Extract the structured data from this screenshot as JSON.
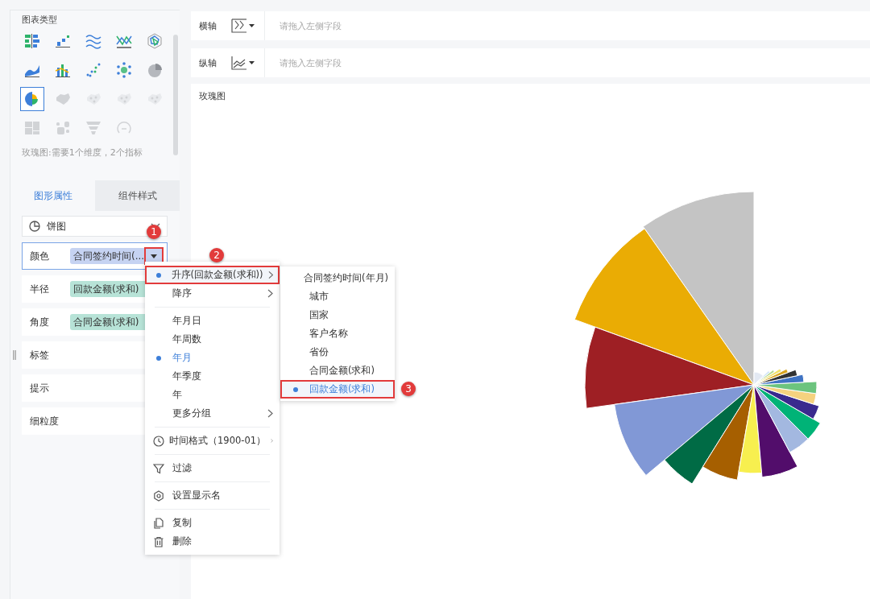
{
  "chart_type_panel": {
    "title": "图表类型",
    "types": [
      {
        "kind": "grouped-bar",
        "selected": false,
        "disabled": false
      },
      {
        "kind": "step-scatter",
        "selected": false,
        "disabled": false
      },
      {
        "kind": "line-wave",
        "selected": false,
        "disabled": false
      },
      {
        "kind": "line-cross",
        "selected": false,
        "disabled": false
      },
      {
        "kind": "radar",
        "selected": false,
        "disabled": false
      },
      {
        "kind": "area",
        "selected": false,
        "disabled": false
      },
      {
        "kind": "combo",
        "selected": false,
        "disabled": false
      },
      {
        "kind": "dot-scatter",
        "selected": false,
        "disabled": false
      },
      {
        "kind": "bubble",
        "selected": false,
        "disabled": false
      },
      {
        "kind": "pie",
        "selected": false,
        "disabled": false
      },
      {
        "kind": "rose",
        "selected": true,
        "disabled": false
      },
      {
        "kind": "map",
        "selected": false,
        "disabled": true
      },
      {
        "kind": "map-points",
        "selected": false,
        "disabled": true
      },
      {
        "kind": "map-points",
        "selected": false,
        "disabled": true
      },
      {
        "kind": "map-points",
        "selected": false,
        "disabled": true
      },
      {
        "kind": "treemap",
        "selected": false,
        "disabled": true
      },
      {
        "kind": "word-cloud",
        "selected": false,
        "disabled": true
      },
      {
        "kind": "funnel",
        "selected": false,
        "disabled": true
      },
      {
        "kind": "gauge",
        "selected": false,
        "disabled": true
      }
    ],
    "caption": "玫瑰图:需要1个维度，2个指标"
  },
  "property_tabs": [
    {
      "label": "图形属性",
      "selected": true
    },
    {
      "label": "组件样式",
      "selected": false
    }
  ],
  "shape_select": {
    "value": "饼图"
  },
  "properties": [
    {
      "label": "颜色",
      "field": "合同签约时间(...",
      "kind": "dimension",
      "active": true,
      "callout": "1"
    },
    {
      "label": "半径",
      "field": "回款金额(求和)",
      "kind": "measure",
      "active": false
    },
    {
      "label": "角度",
      "field": "合同金额(求和)",
      "kind": "measure",
      "active": false
    },
    {
      "label": "标签",
      "kind": "empty",
      "active": false
    },
    {
      "label": "提示",
      "kind": "empty",
      "active": false
    },
    {
      "label": "细粒度",
      "kind": "empty",
      "active": false
    }
  ],
  "axes": [
    {
      "label": "横轴",
      "placeholder": "请拖入左侧字段"
    },
    {
      "label": "纵轴",
      "placeholder": "请拖入左侧字段"
    }
  ],
  "chart": {
    "title": "玫瑰图"
  },
  "context_menu": {
    "groups": [
      [
        {
          "label": "升序(回款金额(求和))",
          "selected": true,
          "submenu": true,
          "highlighted": true,
          "callout": "2"
        },
        {
          "label": "降序",
          "selected": false,
          "submenu": true,
          "highlighted": false
        }
      ],
      [
        {
          "label": "年月日",
          "selected": false,
          "submenu": false,
          "highlighted": false
        },
        {
          "label": "年周数",
          "selected": false,
          "submenu": false,
          "highlighted": false
        },
        {
          "label": "年月",
          "selected": true,
          "submenu": false,
          "highlighted": false
        },
        {
          "label": "年季度",
          "selected": false,
          "submenu": false,
          "highlighted": false
        },
        {
          "label": "年",
          "selected": false,
          "submenu": false,
          "highlighted": false
        },
        {
          "label": "更多分组",
          "selected": false,
          "submenu": true,
          "highlighted": false
        }
      ],
      [
        {
          "label": "时间格式（1900-01）",
          "selected": false,
          "submenu": true,
          "highlighted": false
        }
      ],
      [
        {
          "label": "过滤",
          "selected": false,
          "submenu": false,
          "highlighted": false
        }
      ],
      [
        {
          "label": "设置显示名",
          "selected": false,
          "submenu": false,
          "highlighted": false
        }
      ],
      [
        {
          "label": "复制",
          "selected": false,
          "submenu": false,
          "highlighted": false
        },
        {
          "label": "删除",
          "selected": false,
          "submenu": false,
          "highlighted": false
        }
      ]
    ]
  },
  "submenu": {
    "items": [
      {
        "label": "合同签约时间(年月)",
        "selected": false,
        "highlighted": false
      },
      {
        "label": "城市",
        "selected": false,
        "highlighted": false
      },
      {
        "label": "国家",
        "selected": false,
        "highlighted": false
      },
      {
        "label": "客户名称",
        "selected": false,
        "highlighted": false
      },
      {
        "label": "省份",
        "selected": false,
        "highlighted": false
      },
      {
        "label": "合同金额(求和)",
        "selected": false,
        "highlighted": false
      },
      {
        "label": "回款金额(求和)",
        "selected": true,
        "highlighted": true,
        "callout": "3"
      }
    ]
  }
}
